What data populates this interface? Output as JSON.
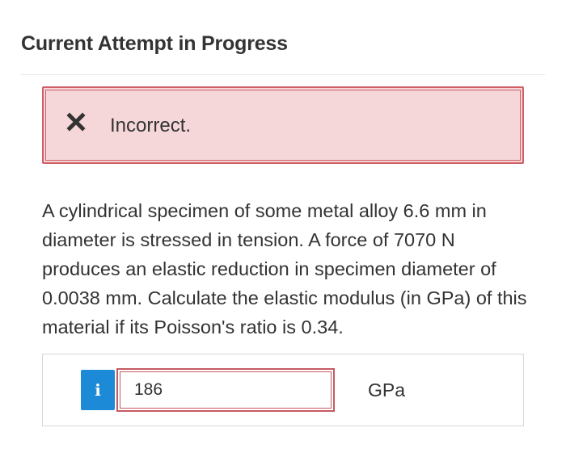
{
  "header": {
    "title": "Current Attempt in Progress"
  },
  "feedback": {
    "icon": "close-x-icon",
    "text": "Incorrect.",
    "colors": {
      "background": "#f6d7d9",
      "border": "#cf5f66",
      "icon": "#333333"
    }
  },
  "question": {
    "text": "A cylindrical specimen of some metal alloy 6.6 mm in diameter is stressed in tension. A force of 7070 N produces an elastic reduction in specimen diameter of 0.0038 mm. Calculate the elastic modulus (in GPa) of this material if its Poisson's ratio is 0.34."
  },
  "answer": {
    "info_label": "i",
    "info_icon": "info-icon",
    "info_color": "#1c8ad6",
    "value": "186",
    "unit": "GPa",
    "input_border_color": "#c55a61"
  }
}
